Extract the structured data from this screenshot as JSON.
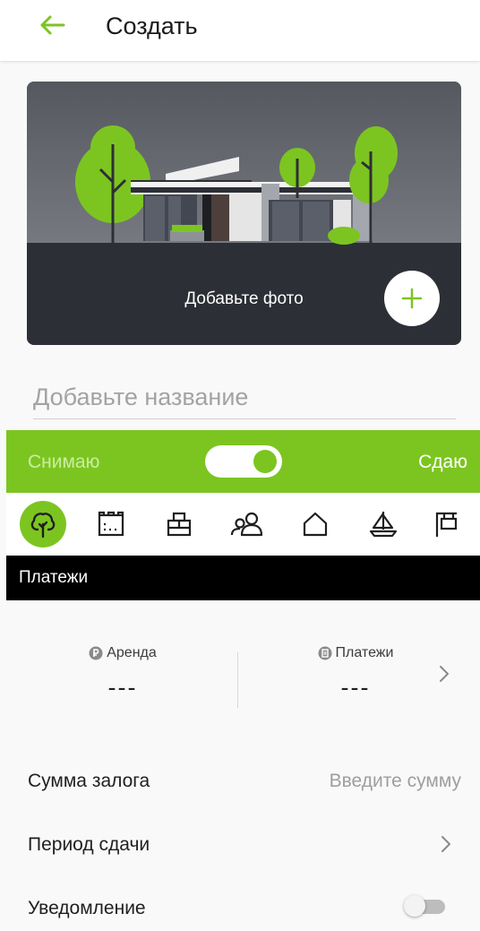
{
  "header": {
    "title": "Создать"
  },
  "photo": {
    "label": "Добавьте фото"
  },
  "name_field": {
    "placeholder": "Добавьте название"
  },
  "mode": {
    "left_label": "Снимаю",
    "right_label": "Сдаю",
    "toggle_on": true
  },
  "categories": [
    {
      "icon": "tree-icon",
      "active": true
    },
    {
      "icon": "building-icon",
      "active": false
    },
    {
      "icon": "office-icon",
      "active": false
    },
    {
      "icon": "people-icon",
      "active": false
    },
    {
      "icon": "house-icon",
      "active": false
    },
    {
      "icon": "boat-icon",
      "active": false
    },
    {
      "icon": "sign-icon",
      "active": false
    }
  ],
  "payments_section": {
    "title": "Платежи"
  },
  "stats": {
    "rent_label": "Аренда",
    "rent_value": "---",
    "payments_label": "Платежи",
    "payments_value": "---"
  },
  "rows": {
    "deposit_label": "Сумма залога",
    "deposit_placeholder": "Введите сумму",
    "period_label": "Период сдачи",
    "notify_label": "Уведомление"
  },
  "colors": {
    "accent": "#7cc521",
    "black": "#000000",
    "background": "#f9f9f9"
  }
}
